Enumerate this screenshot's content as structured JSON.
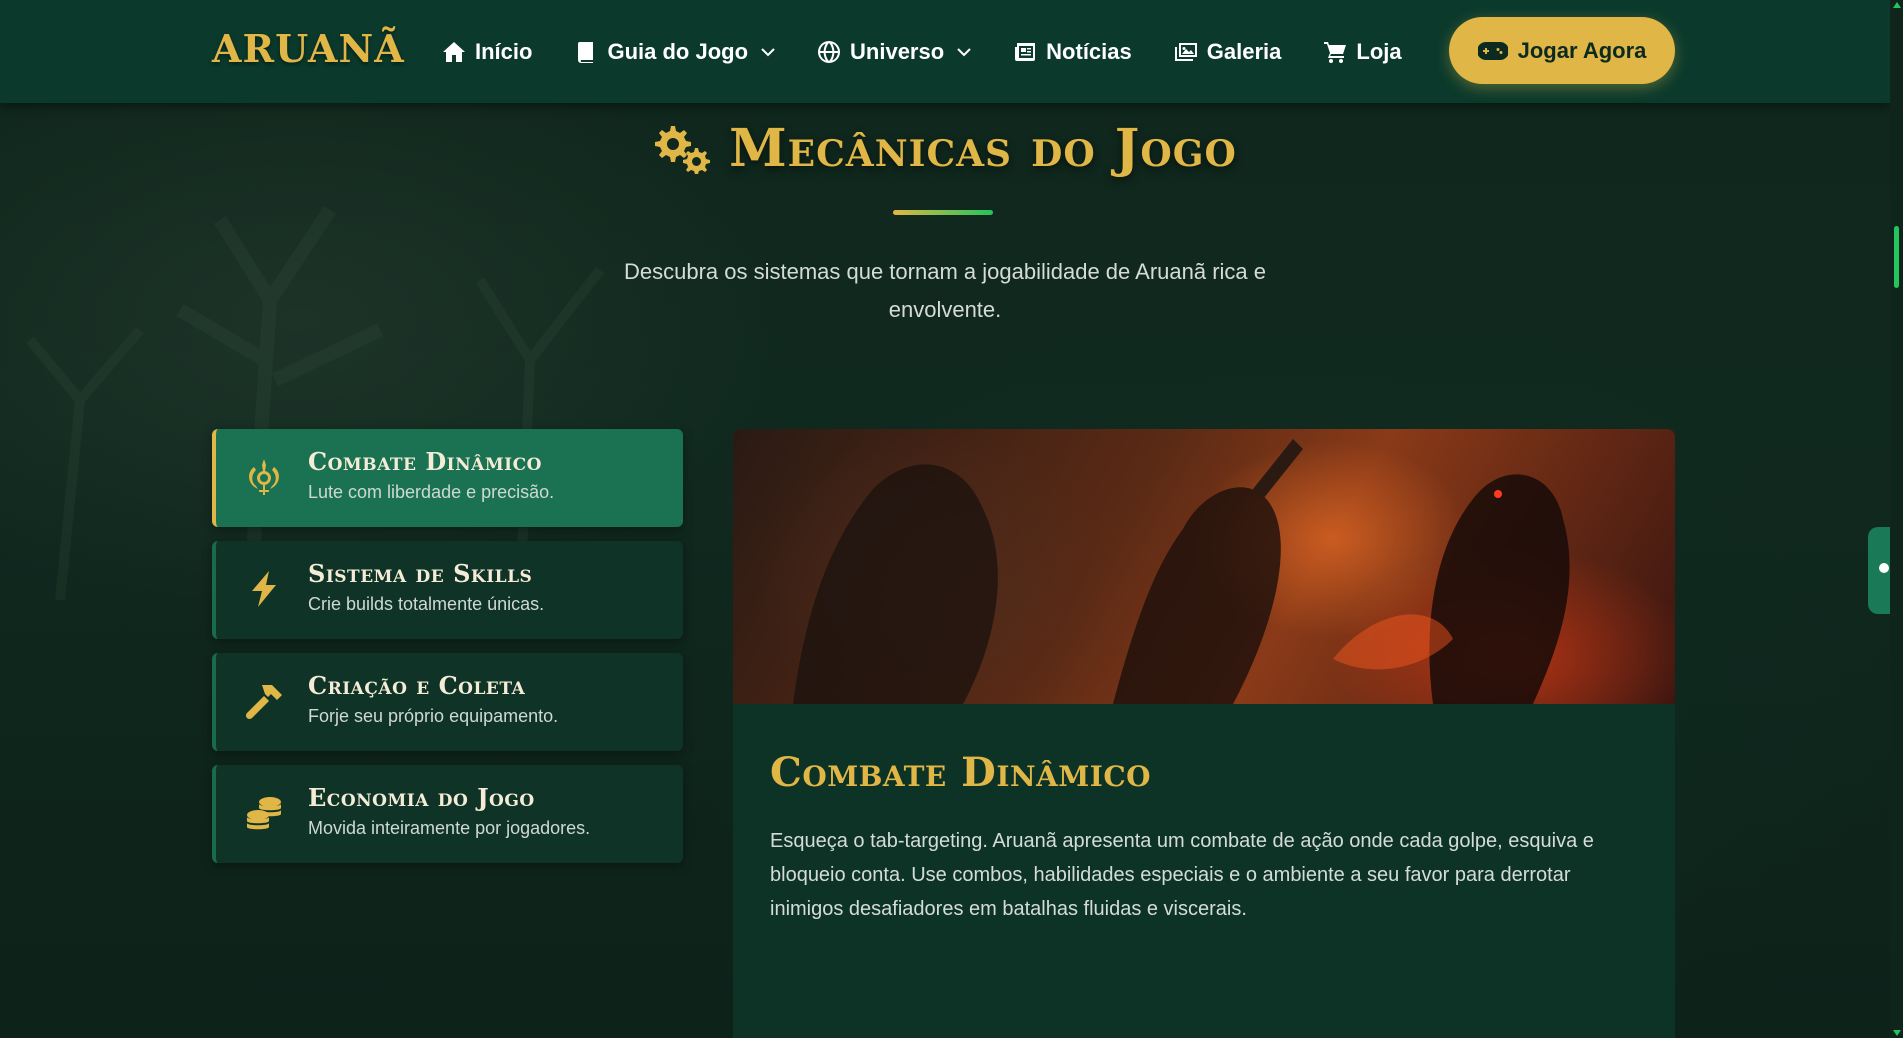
{
  "colors": {
    "brand_gold": "#e0b646",
    "accent_green": "#22c55e",
    "nav_background": "#0b3a2c",
    "active_tab": "#1a7253",
    "page_background": "#0f241b"
  },
  "navbar": {
    "logo": "ARUANÃ",
    "links": [
      {
        "label": "Início",
        "icon": "home-icon"
      },
      {
        "label": "Guia do Jogo",
        "icon": "book-icon",
        "dropdown": true
      },
      {
        "label": "Universo",
        "icon": "globe-icon",
        "dropdown": true
      },
      {
        "label": "Notícias",
        "icon": "newspaper-icon"
      },
      {
        "label": "Galeria",
        "icon": "images-icon"
      },
      {
        "label": "Loja",
        "icon": "cart-icon"
      }
    ],
    "cta": {
      "label": "Jogar Agora",
      "icon": "gamepad-icon"
    }
  },
  "section": {
    "title": "Mecânicas do Jogo",
    "icon": "gears-icon",
    "subtitle": "Descubra os sistemas que tornam a jogabilidade de Aruanã rica e envolvente."
  },
  "tabs": [
    {
      "title": "Combate Dinâmico",
      "desc": "Lute com liberdade e precisão.",
      "icon": "khanda-icon",
      "active": true
    },
    {
      "title": "Sistema de Skills",
      "desc": "Crie builds totalmente únicas.",
      "icon": "bolt-icon",
      "active": false
    },
    {
      "title": "Criação e Coleta",
      "desc": "Forje seu próprio equipamento.",
      "icon": "hammer-icon",
      "active": false
    },
    {
      "title": "Economia do Jogo",
      "desc": "Movida inteiramente por jogadores.",
      "icon": "coins-icon",
      "active": false
    }
  ],
  "detail": {
    "title": "Combate Dinâmico",
    "text": "Esqueça o tab-targeting. Aruanã apresenta um combate de ação onde cada golpe, esquiva e bloqueio conta. Use combos, habilidades especiais e o ambiente a seu favor para derrotar inimigos desafiadores em batalhas fluidas e viscerais."
  }
}
